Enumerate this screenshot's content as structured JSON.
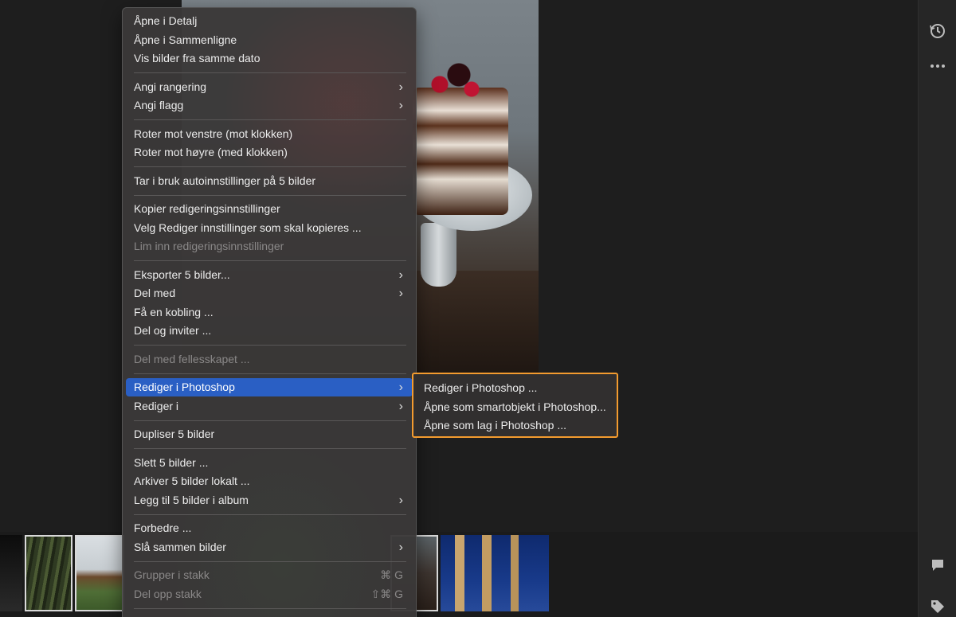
{
  "menu": {
    "items": [
      {
        "label": "Åpne i Detalj"
      },
      {
        "label": "Åpne i Sammenligne"
      },
      {
        "label": "Vis bilder fra samme dato"
      },
      {
        "label": "Angi rangering",
        "arrow": "›"
      },
      {
        "label": "Angi flagg",
        "arrow": "›"
      },
      {
        "label": "Roter mot venstre (mot klokken)"
      },
      {
        "label": "Roter mot høyre (med klokken)"
      },
      {
        "label": "Tar i bruk autoinnstillinger på 5 bilder"
      },
      {
        "label": "Kopier redigeringsinnstillinger"
      },
      {
        "label": "Velg Rediger innstillinger som skal kopieres ..."
      },
      {
        "label": "Lim inn redigeringsinnstillinger"
      },
      {
        "label": "Eksporter 5 bilder...",
        "arrow": "›"
      },
      {
        "label": "Del med",
        "arrow": "›"
      },
      {
        "label": "Få en kobling ..."
      },
      {
        "label": "Del og inviter ..."
      },
      {
        "label": "Del med fellesskapet ..."
      },
      {
        "label": "Rediger i Photoshop",
        "arrow": "›"
      },
      {
        "label": "Rediger i",
        "arrow": "›"
      },
      {
        "label": "Dupliser 5 bilder"
      },
      {
        "label": "Slett 5 bilder ..."
      },
      {
        "label": "Arkiver 5 bilder lokalt ..."
      },
      {
        "label": "Legg til 5 bilder i album",
        "arrow": "›"
      },
      {
        "label": "Forbedre ..."
      },
      {
        "label": "Slå sammen bilder",
        "arrow": "›"
      },
      {
        "label": "Grupper i stakk",
        "shortcut": "⌘ G"
      },
      {
        "label": "Del opp stakk",
        "shortcut": "⇧⌘ G"
      }
    ]
  },
  "submenu": {
    "items": [
      {
        "label": "Rediger i Photoshop ..."
      },
      {
        "label": "Åpne som smartobjekt i Photoshop..."
      },
      {
        "label": "Åpne som lag i Photoshop ..."
      }
    ]
  },
  "icons": {
    "history": "history-icon",
    "more": "more-icon",
    "comment": "comment-icon",
    "tag": "tag-icon"
  },
  "colors": {
    "highlight": "#2a5fc4",
    "submenu_border": "#f39b2f"
  }
}
